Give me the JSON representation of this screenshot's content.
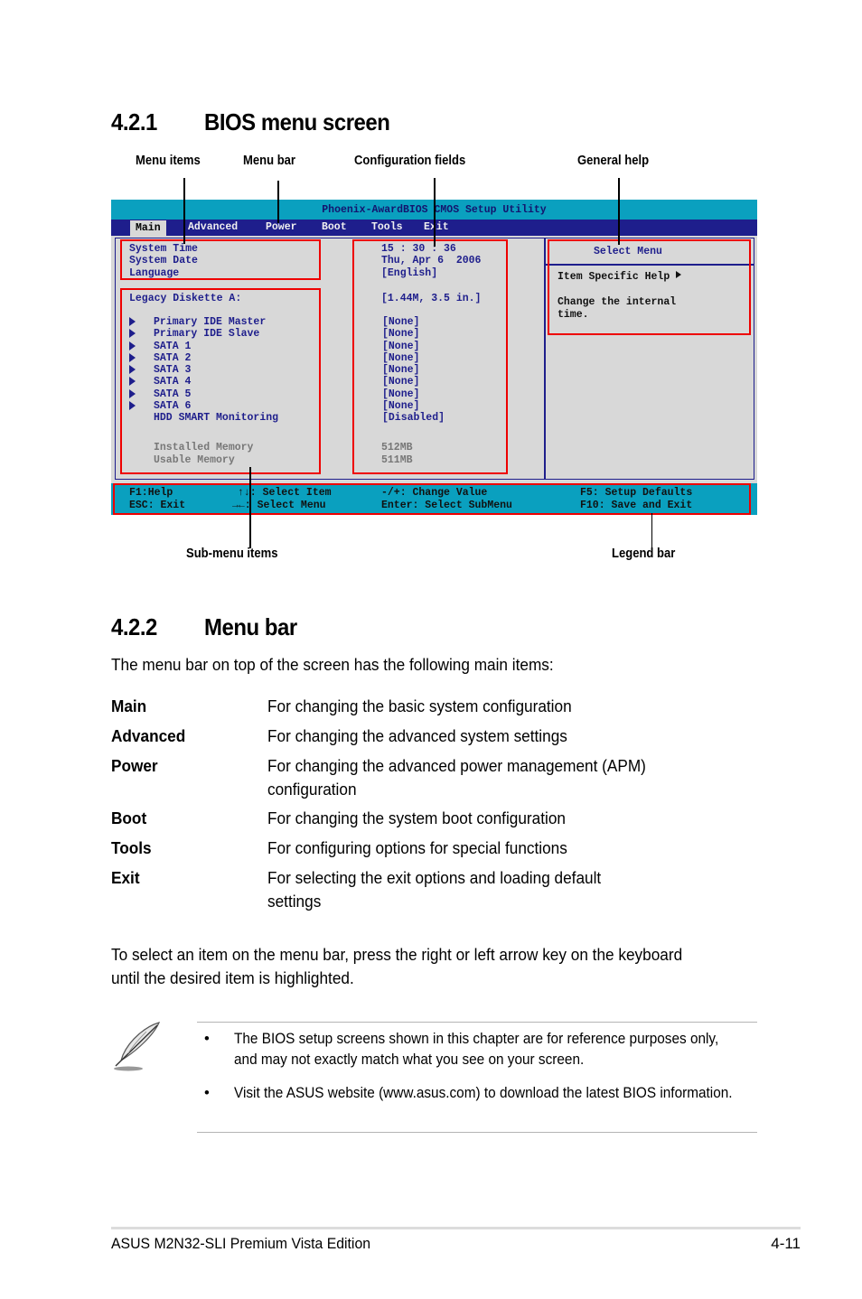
{
  "section1": {
    "number": "4.2.1",
    "title": "BIOS menu screen",
    "callouts": {
      "menu_items": "Menu items",
      "menu_bar": "Menu bar",
      "configuration_fields": "Configuration fields",
      "general_help": "General help",
      "sub_menu_items": "Sub-menu items",
      "legend_bar": "Legend bar"
    }
  },
  "bios": {
    "title": "Phoenix-AwardBIOS CMOS Setup Utility",
    "menu": [
      {
        "label": "Main",
        "active": true
      },
      {
        "label": "Advanced"
      },
      {
        "label": "Power"
      },
      {
        "label": "Boot"
      },
      {
        "label": "Tools"
      },
      {
        "label": "Exit"
      }
    ],
    "items": [
      {
        "label": "System Time",
        "value": "15 : 30 : 36"
      },
      {
        "label": "System Date",
        "value": "Thu, Apr 6  2006"
      },
      {
        "label": "Language",
        "value": "[English]"
      },
      {
        "label": "Legacy Diskette A:",
        "value": "[1.44M, 3.5 in.]"
      }
    ],
    "submenus": [
      {
        "label": "Primary IDE Master",
        "value": "[None]"
      },
      {
        "label": "Primary IDE Slave",
        "value": "[None]"
      },
      {
        "label": "SATA 1",
        "value": "[None]"
      },
      {
        "label": "SATA 2",
        "value": "[None]"
      },
      {
        "label": "SATA 3",
        "value": "[None]"
      },
      {
        "label": "SATA 4",
        "value": "[None]"
      },
      {
        "label": "SATA 5",
        "value": "[None]"
      },
      {
        "label": "SATA 6",
        "value": "[None]"
      }
    ],
    "hdd_smart": {
      "label": "HDD SMART Monitoring",
      "value": "[Disabled]"
    },
    "memory": [
      {
        "label": "Installed Memory",
        "value": "512MB"
      },
      {
        "label": "Usable Memory",
        "value": "511MB"
      }
    ],
    "help": {
      "title": "Select Menu",
      "heading": "Item Specific Help",
      "text_line1": "Change the internal",
      "text_line2": "time."
    },
    "legend": {
      "f1": "F1:Help",
      "esc": "ESC: Exit",
      "updown": "↑↓: Select Item",
      "leftright": "→←: Select Menu",
      "plusminus": "-/+: Change Value",
      "enter": "Enter: Select SubMenu",
      "f5": "F5: Setup Defaults",
      "f10": "F10: Save and Exit"
    },
    "colors": {
      "title_bg": "#0aa0bf",
      "menubar_bg": "#1e1e8c",
      "body_bg": "#d8d8d8",
      "highlight": "#ee0000"
    }
  },
  "section2": {
    "number": "4.2.2",
    "title": "Menu bar",
    "intro": "The menu bar on top of the screen has the following main items:",
    "definitions": [
      {
        "term": "Main",
        "desc": "For changing the basic system configuration"
      },
      {
        "term": "Advanced",
        "desc": "For changing the advanced system settings"
      },
      {
        "term": "Power",
        "desc": "For changing the advanced power management (APM) configuration"
      },
      {
        "term": "Boot",
        "desc": "For changing the system boot configuration"
      },
      {
        "term": "Tools",
        "desc": "For configuring options for special functions"
      },
      {
        "term": "Exit",
        "desc": "For selecting the exit options and loading default settings"
      }
    ],
    "instruction": "To select an item on the menu bar, press the right or left arrow key on the keyboard",
    "instruction_line2": "until the desired item is highlighted."
  },
  "note": {
    "icon": "feather-pen-icon",
    "bullet": "•",
    "items": [
      "The BIOS setup screens shown in this chapter are for reference purposes only, and may not exactly match what you see on your screen.",
      "Visit the ASUS website (www.asus.com) to download the latest BIOS information."
    ]
  },
  "footer": {
    "product": "ASUS M2N32-SLI Premium Vista Edition",
    "page": "4-11"
  }
}
